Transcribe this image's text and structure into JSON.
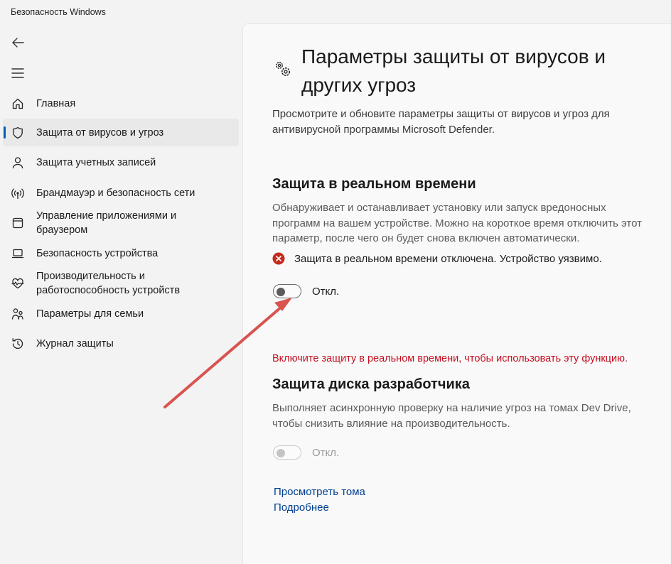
{
  "app": {
    "title": "Безопасность Windows"
  },
  "nav": {
    "items": [
      {
        "label": "Главная",
        "icon": "home-icon",
        "active": false
      },
      {
        "label": "Защита от вирусов и угроз",
        "icon": "shield-icon",
        "active": true
      },
      {
        "label": "Защита учетных записей",
        "icon": "person-icon",
        "active": false
      },
      {
        "label": "Брандмауэр и безопасность сети",
        "icon": "wifi-icon",
        "active": false
      },
      {
        "label": "Управление приложениями и браузером",
        "icon": "app-window-icon",
        "active": false
      },
      {
        "label": "Безопасность устройства",
        "icon": "laptop-icon",
        "active": false
      },
      {
        "label": "Производительность и работоспособность устройств",
        "icon": "heart-pulse-icon",
        "active": false
      },
      {
        "label": "Параметры для семьи",
        "icon": "family-icon",
        "active": false
      },
      {
        "label": "Журнал защиты",
        "icon": "history-icon",
        "active": false
      }
    ]
  },
  "page": {
    "title": "Параметры защиты от вирусов и других угроз",
    "description": "Просмотрите и обновите параметры защиты от вирусов и угроз для антивирусной программы Microsoft Defender."
  },
  "realtime": {
    "title": "Защита в реальном времени",
    "description": "Обнаруживает и останавливает установку или запуск вредоносных программ на вашем устройстве. Можно на короткое время отключить этот параметр, после чего он будет снова включен автоматически.",
    "alert": "Защита в реальном времени отключена. Устройство уязвимо.",
    "toggle_label": "Откл.",
    "toggle_on": false
  },
  "warning": "Включите защиту в реальном времени, чтобы использовать эту функцию.",
  "devdrive": {
    "title": "Защита диска разработчика",
    "description": "Выполняет асинхронную проверку на наличие угроз на томах Dev Drive, чтобы снизить влияние на производительность.",
    "toggle_label": "Откл.",
    "toggle_on": false
  },
  "links": {
    "view_volumes": "Просмотреть тома",
    "learn_more": "Подробнее"
  },
  "colors": {
    "accent": "#005fb8",
    "error": "#c42b1c",
    "warning_text": "#c50f1f",
    "link": "#003e92",
    "annotation_arrow": "#d9534f"
  }
}
